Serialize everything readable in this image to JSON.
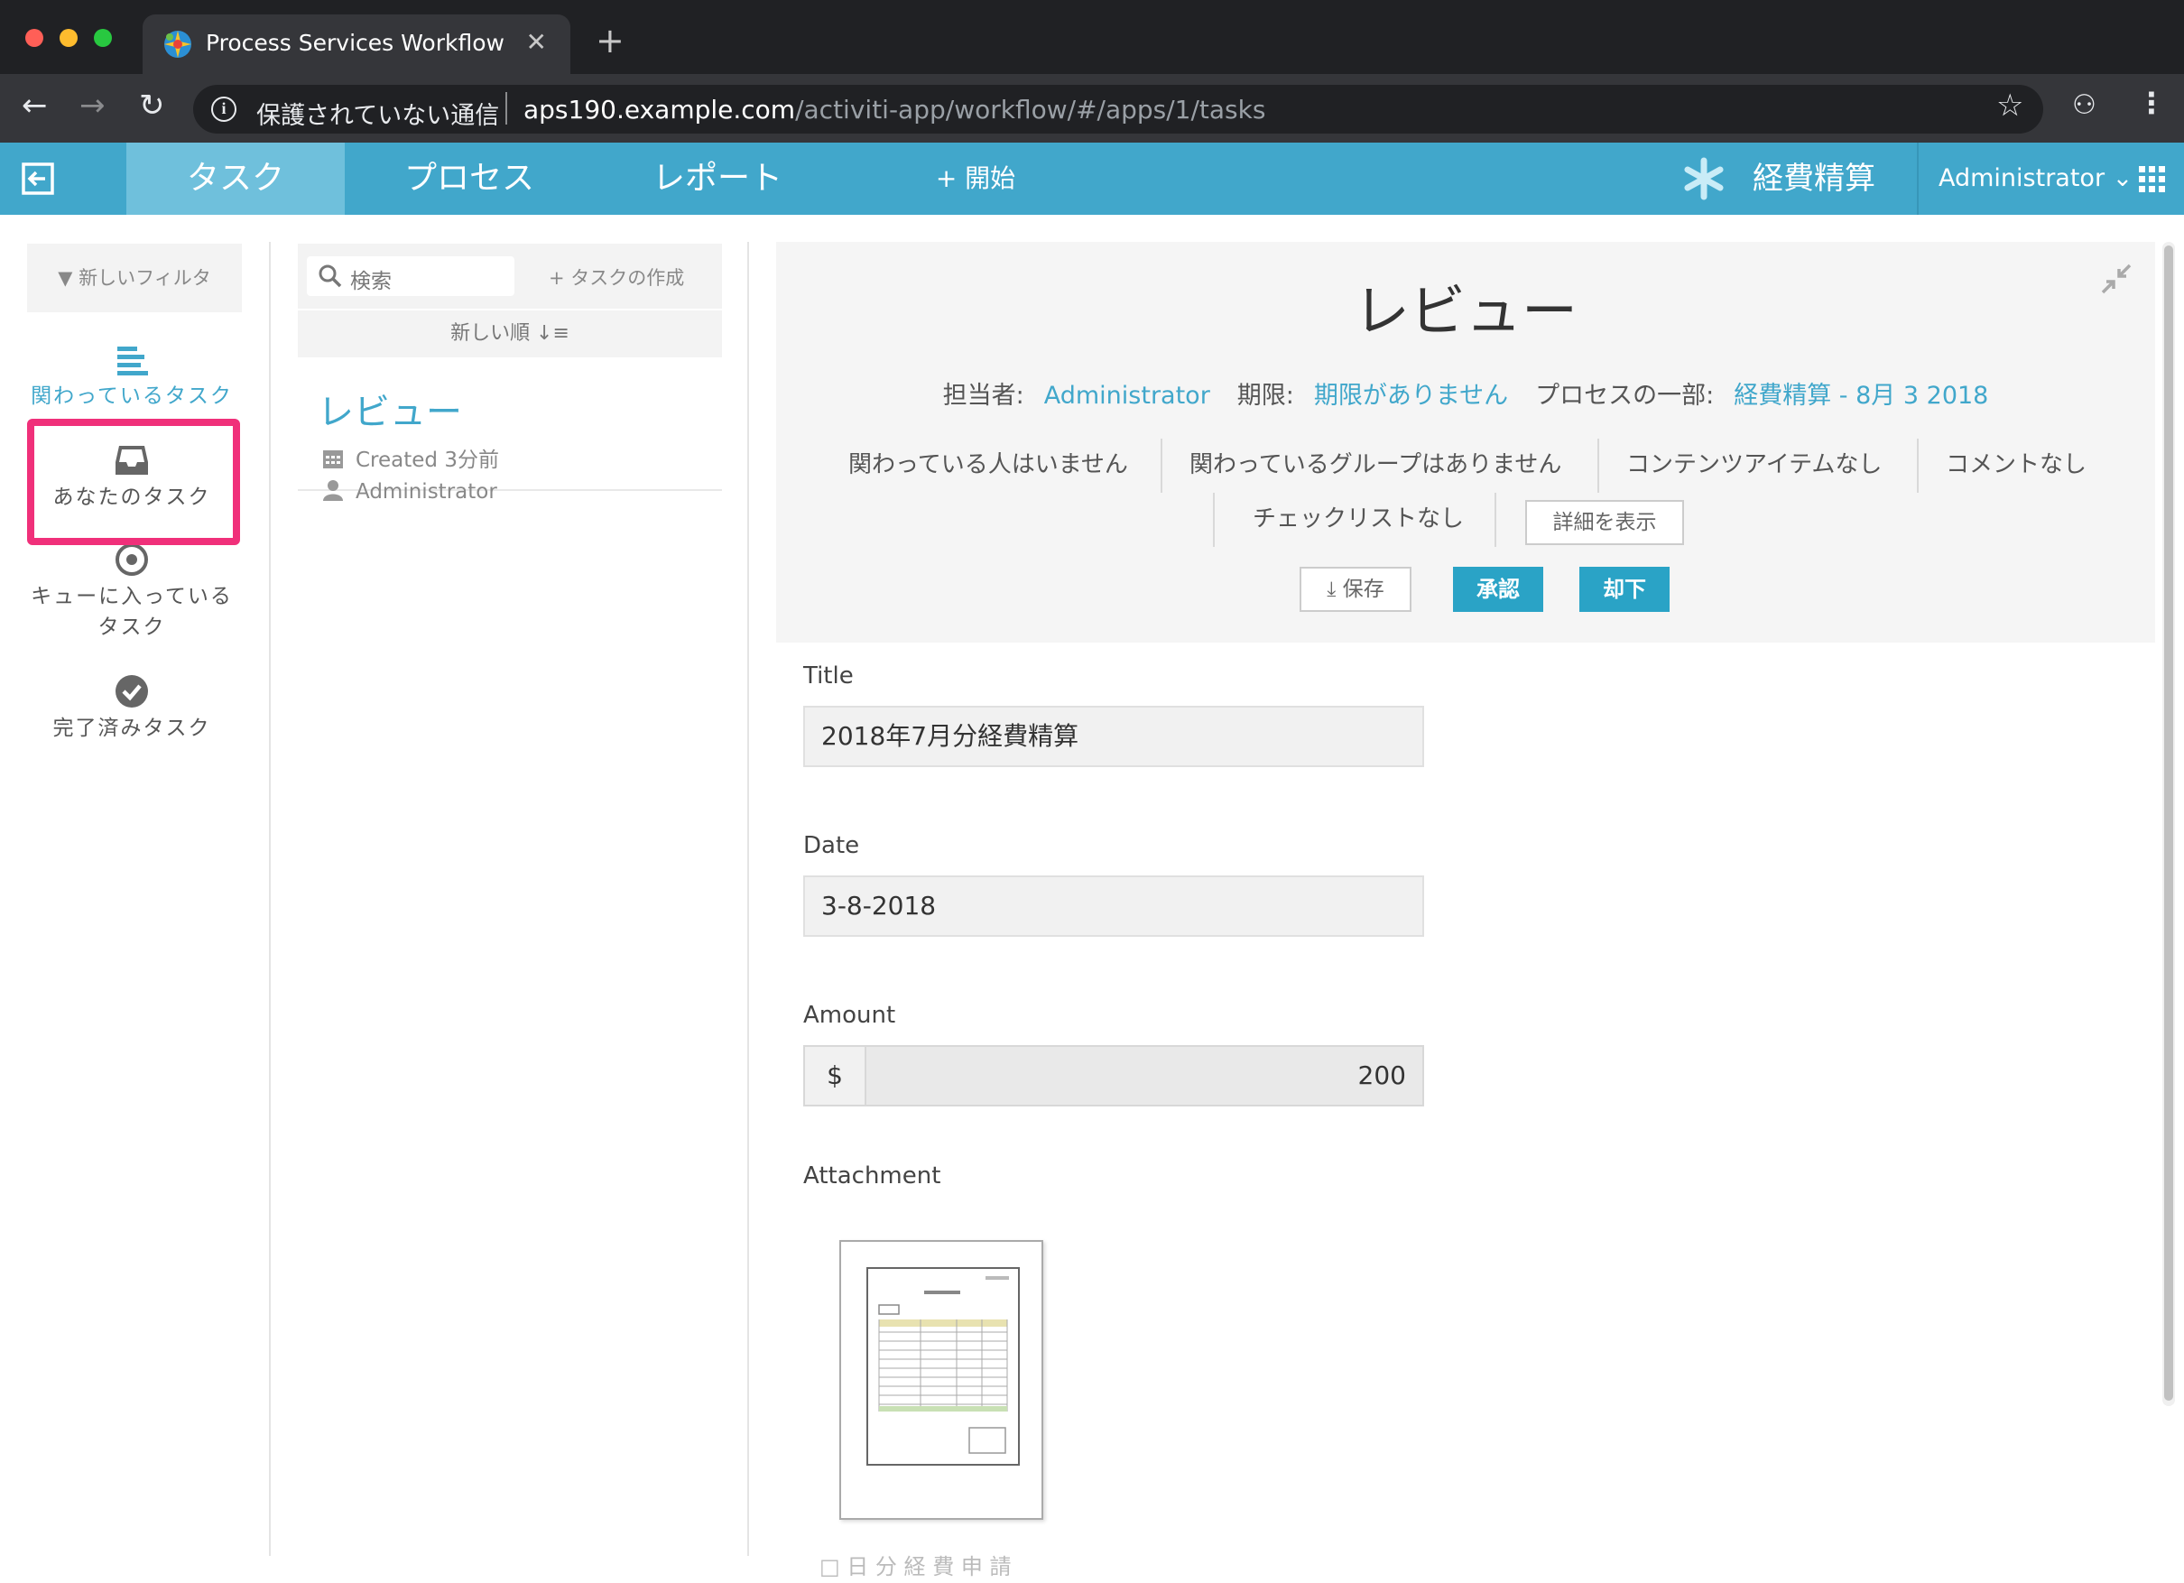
{
  "browser": {
    "tab_title": "Process Services Workflow",
    "tab_close": "✕",
    "new_tab": "+",
    "security_label": "保護されていない通信",
    "url_host": "aps190.example.com",
    "url_path": "/activiti-app/workflow/#/apps/1/tasks",
    "info_glyph": "i",
    "star_glyph": "☆",
    "incognito_glyph": "⚇",
    "menu_glyph": "⋮",
    "back_glyph": "←",
    "forward_glyph": "→",
    "reload_glyph": "↻"
  },
  "header": {
    "nav": [
      {
        "label": "タスク",
        "active": true
      },
      {
        "label": "プロセス"
      },
      {
        "label": "レポート"
      },
      {
        "label": "+ 開始"
      }
    ],
    "app_name": "経費精算",
    "user": "Administrator ⌄",
    "accent_color": "#41a7cb"
  },
  "filters": {
    "new_filter": "▼ 新しいフィルタ",
    "items": [
      {
        "label": "関わっているタスク",
        "icon": "list-icon",
        "active": true
      },
      {
        "label": "あなたのタスク",
        "icon": "inbox-icon",
        "highlighted": true
      },
      {
        "label": "キューに入っているタスク",
        "icon": "target-icon"
      },
      {
        "label": "完了済みタスク",
        "icon": "check-circle-icon"
      }
    ]
  },
  "tasklist": {
    "search_placeholder": "検索",
    "create_task": "+ タスクの作成",
    "sort_label": "新しい順 ↓≡",
    "tasks": [
      {
        "name": "レビュー",
        "created": "Created 3分前",
        "assignee": "Administrator"
      }
    ]
  },
  "detail": {
    "title": "レビュー",
    "assignee_label": "担当者:",
    "assignee": "Administrator",
    "due_label": "期限:",
    "due": "期限がありません",
    "process_label": "プロセスの一部:",
    "process": "経費精算 - 8月 3 2018",
    "stats": {
      "people": "関わっている人はいません",
      "groups": "関わっているグループはありません",
      "content": "コンテンツアイテムなし",
      "comments": "コメントなし",
      "checklist": "チェックリストなし"
    },
    "show_details": "詳細を表示",
    "save": "⤓ 保存",
    "approve": "承認",
    "reject": "却下"
  },
  "form": {
    "title_label": "Title",
    "title_value": "2018年7月分経費精算",
    "date_label": "Date",
    "date_value": "3-8-2018",
    "amount_label": "Amount",
    "amount_prefix": "$",
    "amount_value": "200",
    "attachment_label": "Attachment",
    "attachment_caption": "□ 日 分 経 費 申 請"
  }
}
